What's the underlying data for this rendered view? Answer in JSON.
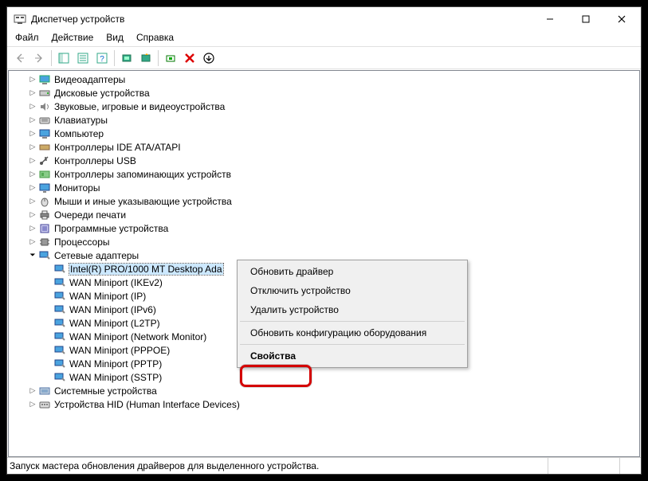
{
  "window": {
    "title": "Диспетчер устройств"
  },
  "menu": {
    "file": "Файл",
    "action": "Действие",
    "view": "Вид",
    "help": "Справка"
  },
  "tree": {
    "n0": "Видеоадаптеры",
    "n1": "Дисковые устройства",
    "n2": "Звуковые, игровые и видеоустройства",
    "n3": "Клавиатуры",
    "n4": "Компьютер",
    "n5": "Контроллеры IDE ATA/ATAPI",
    "n6": "Контроллеры USB",
    "n7": "Контроллеры запоминающих устройств",
    "n8": "Мониторы",
    "n9": "Мыши и иные указывающие устройства",
    "n10": "Очереди печати",
    "n11": "Программные устройства",
    "n12": "Процессоры",
    "n13": "Сетевые адаптеры",
    "n13c0": "Intel(R) PRO/1000 MT Desktop Ada",
    "n13c1": "WAN Miniport (IKEv2)",
    "n13c2": "WAN Miniport (IP)",
    "n13c3": "WAN Miniport (IPv6)",
    "n13c4": "WAN Miniport (L2TP)",
    "n13c5": "WAN Miniport (Network Monitor)",
    "n13c6": "WAN Miniport (PPPOE)",
    "n13c7": "WAN Miniport (PPTP)",
    "n13c8": "WAN Miniport (SSTP)",
    "n14": "Системные устройства",
    "n15": "Устройства HID (Human Interface Devices)"
  },
  "context_menu": {
    "m0": "Обновить драйвер",
    "m1": "Отключить устройство",
    "m2": "Удалить устройство",
    "m3": "Обновить конфигурацию оборудования",
    "m4": "Свойства"
  },
  "statusbar": {
    "text": "Запуск мастера обновления драйверов для выделенного устройства."
  }
}
